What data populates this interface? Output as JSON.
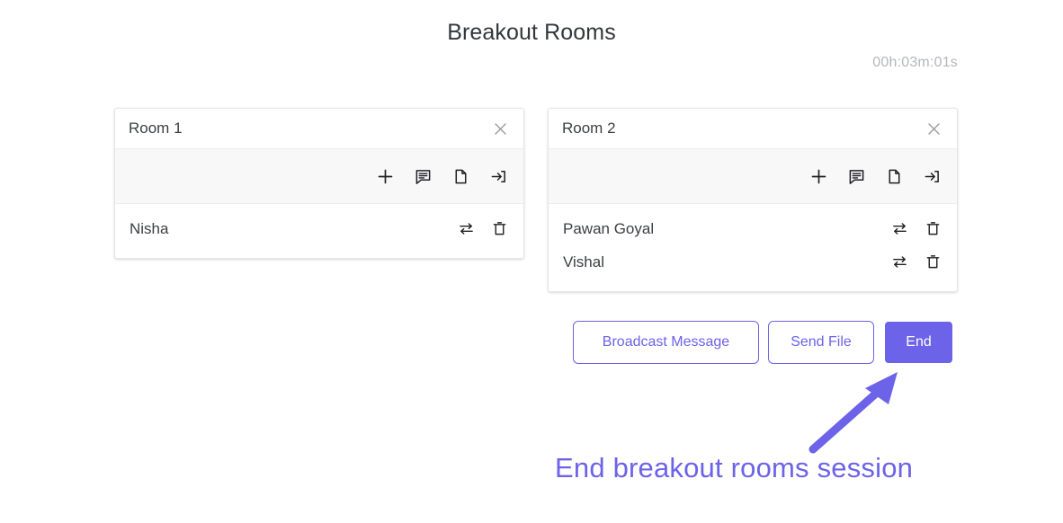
{
  "header": {
    "title": "Breakout Rooms",
    "timer": "00h:03m:01s"
  },
  "rooms": [
    {
      "title": "Room 1",
      "close_icon": "close-icon",
      "toolbar": [
        {
          "icon": "plus-icon",
          "label": "Add participant"
        },
        {
          "icon": "chat-icon",
          "label": "Message room"
        },
        {
          "icon": "file-icon",
          "label": "Send file"
        },
        {
          "icon": "join-room-icon",
          "label": "Join room"
        }
      ],
      "participants": [
        {
          "name": "Nisha",
          "swap_icon": "swap-icon",
          "delete_icon": "trash-icon"
        }
      ]
    },
    {
      "title": "Room 2",
      "close_icon": "close-icon",
      "toolbar": [
        {
          "icon": "plus-icon",
          "label": "Add participant"
        },
        {
          "icon": "chat-icon",
          "label": "Message room"
        },
        {
          "icon": "file-icon",
          "label": "Send file"
        },
        {
          "icon": "join-room-icon",
          "label": "Join room"
        }
      ],
      "participants": [
        {
          "name": "Pawan Goyal",
          "swap_icon": "swap-icon",
          "delete_icon": "trash-icon"
        },
        {
          "name": "Vishal",
          "swap_icon": "swap-icon",
          "delete_icon": "trash-icon"
        }
      ]
    }
  ],
  "actions": {
    "broadcast_label": "Broadcast Message",
    "send_file_label": "Send File",
    "end_label": "End"
  },
  "annotation": {
    "text": "End breakout rooms session",
    "arrow_icon": "arrow-up-right-icon"
  },
  "colors": {
    "accent": "#6c63e8",
    "text": "#3c4043",
    "muted": "#b4b7bb",
    "toolbar_bg": "#f8f8f8",
    "border": "#e6e6e6"
  }
}
